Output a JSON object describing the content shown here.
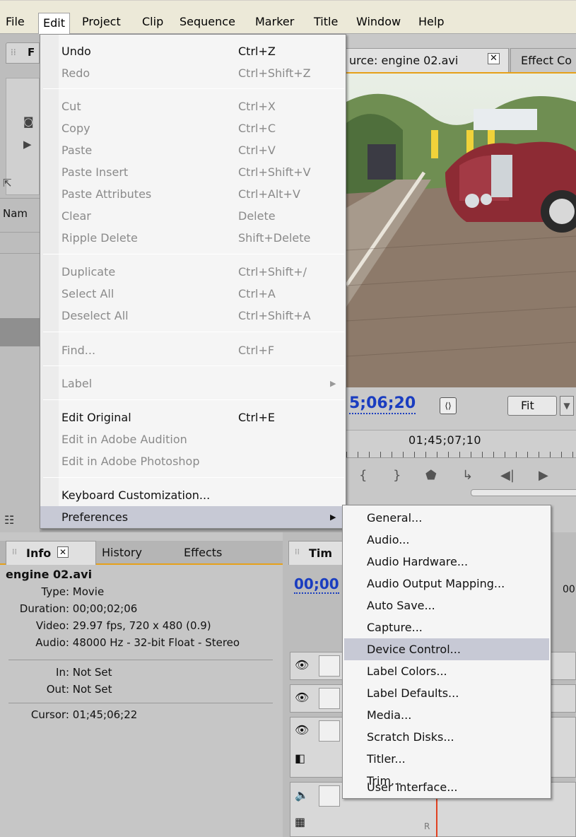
{
  "menubar": {
    "items": [
      "File",
      "Edit",
      "Project",
      "Clip",
      "Sequence",
      "Marker",
      "Title",
      "Window",
      "Help"
    ],
    "active": "Edit"
  },
  "left_panel": {
    "header_letter": "F",
    "column_name": "Nam"
  },
  "monitor": {
    "source_tab": "urce: engine 02.avi",
    "effect_tab": "Effect Co",
    "timecode": "5;06;20",
    "fit": "Fit",
    "ruler_time": "01;45;07;10"
  },
  "edit_menu": {
    "items": [
      {
        "label": "Undo",
        "shortcut": "Ctrl+Z",
        "enabled": true
      },
      {
        "label": "Redo",
        "shortcut": "Ctrl+Shift+Z",
        "enabled": false
      },
      {
        "label": "Cut",
        "shortcut": "Ctrl+X",
        "enabled": false
      },
      {
        "label": "Copy",
        "shortcut": "Ctrl+C",
        "enabled": false
      },
      {
        "label": "Paste",
        "shortcut": "Ctrl+V",
        "enabled": false
      },
      {
        "label": "Paste Insert",
        "shortcut": "Ctrl+Shift+V",
        "enabled": false
      },
      {
        "label": "Paste Attributes",
        "shortcut": "Ctrl+Alt+V",
        "enabled": false
      },
      {
        "label": "Clear",
        "shortcut": "Delete",
        "enabled": false
      },
      {
        "label": "Ripple Delete",
        "shortcut": "Shift+Delete",
        "enabled": false
      },
      {
        "label": "Duplicate",
        "shortcut": "Ctrl+Shift+/",
        "enabled": false
      },
      {
        "label": "Select All",
        "shortcut": "Ctrl+A",
        "enabled": false
      },
      {
        "label": "Deselect All",
        "shortcut": "Ctrl+Shift+A",
        "enabled": false
      },
      {
        "label": "Find...",
        "shortcut": "Ctrl+F",
        "enabled": false
      },
      {
        "label": "Label",
        "shortcut": "",
        "enabled": false
      },
      {
        "label": "Edit Original",
        "shortcut": "Ctrl+E",
        "enabled": true
      },
      {
        "label": "Edit in Adobe Audition",
        "shortcut": "",
        "enabled": false
      },
      {
        "label": "Edit in Adobe Photoshop",
        "shortcut": "",
        "enabled": false
      },
      {
        "label": "Keyboard Customization...",
        "shortcut": "",
        "enabled": true
      },
      {
        "label": "Preferences",
        "shortcut": "",
        "enabled": true
      }
    ]
  },
  "preferences_menu": {
    "items": [
      "General...",
      "Audio...",
      "Audio Hardware...",
      "Audio Output Mapping...",
      "Auto Save...",
      "Capture...",
      "Device Control...",
      "Label Colors...",
      "Label Defaults...",
      "Media...",
      "Scratch Disks...",
      "Titler...",
      "Trim...",
      "User Interface..."
    ],
    "highlighted": "Device Control..."
  },
  "info_panel": {
    "tabs": [
      "Info",
      "History",
      "Effects"
    ],
    "clip_name": "engine 02.avi",
    "rows": [
      {
        "key": "Type:",
        "value": "Movie"
      },
      {
        "key": "Duration:",
        "value": "00;00;02;06"
      },
      {
        "key": "Video:",
        "value": "29.97 fps, 720 x 480 (0.9)"
      },
      {
        "key": "Audio:",
        "value": "48000 Hz - 32-bit Float - Stereo"
      },
      {
        "key": "In:",
        "value": "Not Set"
      },
      {
        "key": "Out:",
        "value": "Not Set"
      },
      {
        "key": "Cursor:",
        "value": "01;45;06;22"
      }
    ]
  },
  "timeline": {
    "tab": "Tim",
    "timecode": "00;00",
    "ruler_text": "00",
    "track_label": "R"
  }
}
